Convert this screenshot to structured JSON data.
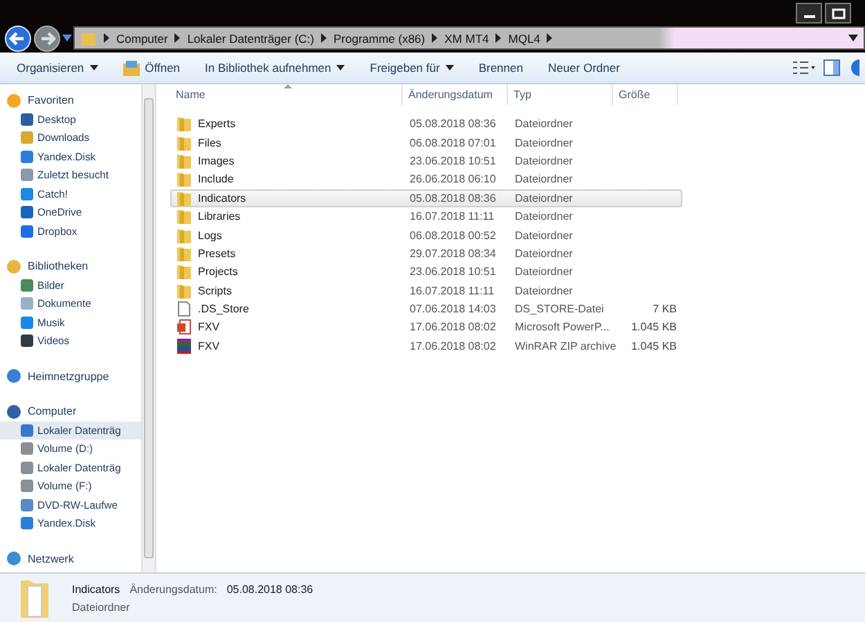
{
  "breadcrumb": [
    "Computer",
    "Lokaler Datenträger (C:)",
    "Programme (x86)",
    "XM MT4",
    "MQL4"
  ],
  "toolbar": [
    {
      "label": "Organisieren",
      "dropdown": true
    },
    {
      "label": "Öffnen",
      "dropdown": false
    },
    {
      "label": "In Bibliothek aufnehmen",
      "dropdown": true
    },
    {
      "label": "Freigeben für",
      "dropdown": true
    },
    {
      "label": "Brennen",
      "dropdown": false
    },
    {
      "label": "Neuer Ordner",
      "dropdown": false
    }
  ],
  "sidebar": {
    "groups": [
      {
        "label": "Favoriten",
        "children": [
          {
            "label": "Desktop",
            "selected": false
          },
          {
            "label": "Downloads",
            "selected": false
          },
          {
            "label": "Yandex.Disk",
            "selected": false
          },
          {
            "label": "Zuletzt besucht",
            "selected": false
          },
          {
            "label": "Catch!",
            "selected": false
          },
          {
            "label": "OneDrive",
            "selected": false
          },
          {
            "label": "Dropbox",
            "selected": false
          }
        ]
      },
      {
        "label": "Bibliotheken",
        "children": [
          {
            "label": "Bilder",
            "selected": false
          },
          {
            "label": "Dokumente",
            "selected": false
          },
          {
            "label": "Musik",
            "selected": false
          },
          {
            "label": "Videos",
            "selected": false
          }
        ]
      },
      {
        "label": "Heimnetzgruppe"
      },
      {
        "label": "Computer",
        "children": [
          {
            "label": "Lokaler Datenträg",
            "selected": true
          },
          {
            "label": "Volume (D:)",
            "selected": false
          },
          {
            "label": "Lokaler Datenträg",
            "selected": false
          },
          {
            "label": "Volume (F:)",
            "selected": false
          },
          {
            "label": "DVD-RW-Laufwe",
            "selected": false
          },
          {
            "label": "Yandex.Disk",
            "selected": false
          }
        ]
      },
      {
        "label": "Netzwerk"
      }
    ]
  },
  "table": {
    "columns": [
      "Name",
      "Änderungsdatum",
      "Typ",
      "Größe"
    ],
    "rows": [
      {
        "kind": "folder",
        "name": "Experts",
        "date": "05.08.2018 08:36",
        "type": "Dateiordner",
        "size": null,
        "selected": false
      },
      {
        "kind": "folder",
        "name": "Files",
        "date": "06.08.2018 07:01",
        "type": "Dateiordner",
        "size": null,
        "selected": false
      },
      {
        "kind": "folder",
        "name": "Images",
        "date": "23.06.2018 10:51",
        "type": "Dateiordner",
        "size": null,
        "selected": false
      },
      {
        "kind": "folder",
        "name": "Include",
        "date": "26.06.2018 06:10",
        "type": "Dateiordner",
        "size": null,
        "selected": false
      },
      {
        "kind": "folder",
        "name": "Indicators",
        "date": "05.08.2018 08:36",
        "type": "Dateiordner",
        "size": null,
        "selected": true
      },
      {
        "kind": "folder",
        "name": "Libraries",
        "date": "16.07.2018 11:11",
        "type": "Dateiordner",
        "size": null,
        "selected": false
      },
      {
        "kind": "folder",
        "name": "Logs",
        "date": "06.08.2018 00:52",
        "type": "Dateiordner",
        "size": null,
        "selected": false
      },
      {
        "kind": "folder",
        "name": "Presets",
        "date": "29.07.2018 08:34",
        "type": "Dateiordner",
        "size": null,
        "selected": false
      },
      {
        "kind": "folder",
        "name": "Projects",
        "date": "23.06.2018 10:51",
        "type": "Dateiordner",
        "size": null,
        "selected": false
      },
      {
        "kind": "folder",
        "name": "Scripts",
        "date": "16.07.2018 11:11",
        "type": "Dateiordner",
        "size": null,
        "selected": false
      },
      {
        "kind": "file",
        "name": ".DS_Store",
        "date": "07.06.2018 14:03",
        "type": "DS_STORE-Datei",
        "size": "7 KB",
        "selected": false
      },
      {
        "kind": "presentation",
        "name": "FXV",
        "date": "17.06.2018 08:02",
        "type": "Microsoft PowerP...",
        "size": "1.045 KB",
        "selected": false
      },
      {
        "kind": "archive",
        "name": "FXV",
        "date": "17.06.2018 08:02",
        "type": "WinRAR ZIP archive",
        "size": "1.045 KB",
        "selected": false
      }
    ]
  },
  "details": {
    "name": "Indicators",
    "date_label": "Änderungsdatum:",
    "date": "05.08.2018 08:36",
    "type": "Dateiordner"
  }
}
